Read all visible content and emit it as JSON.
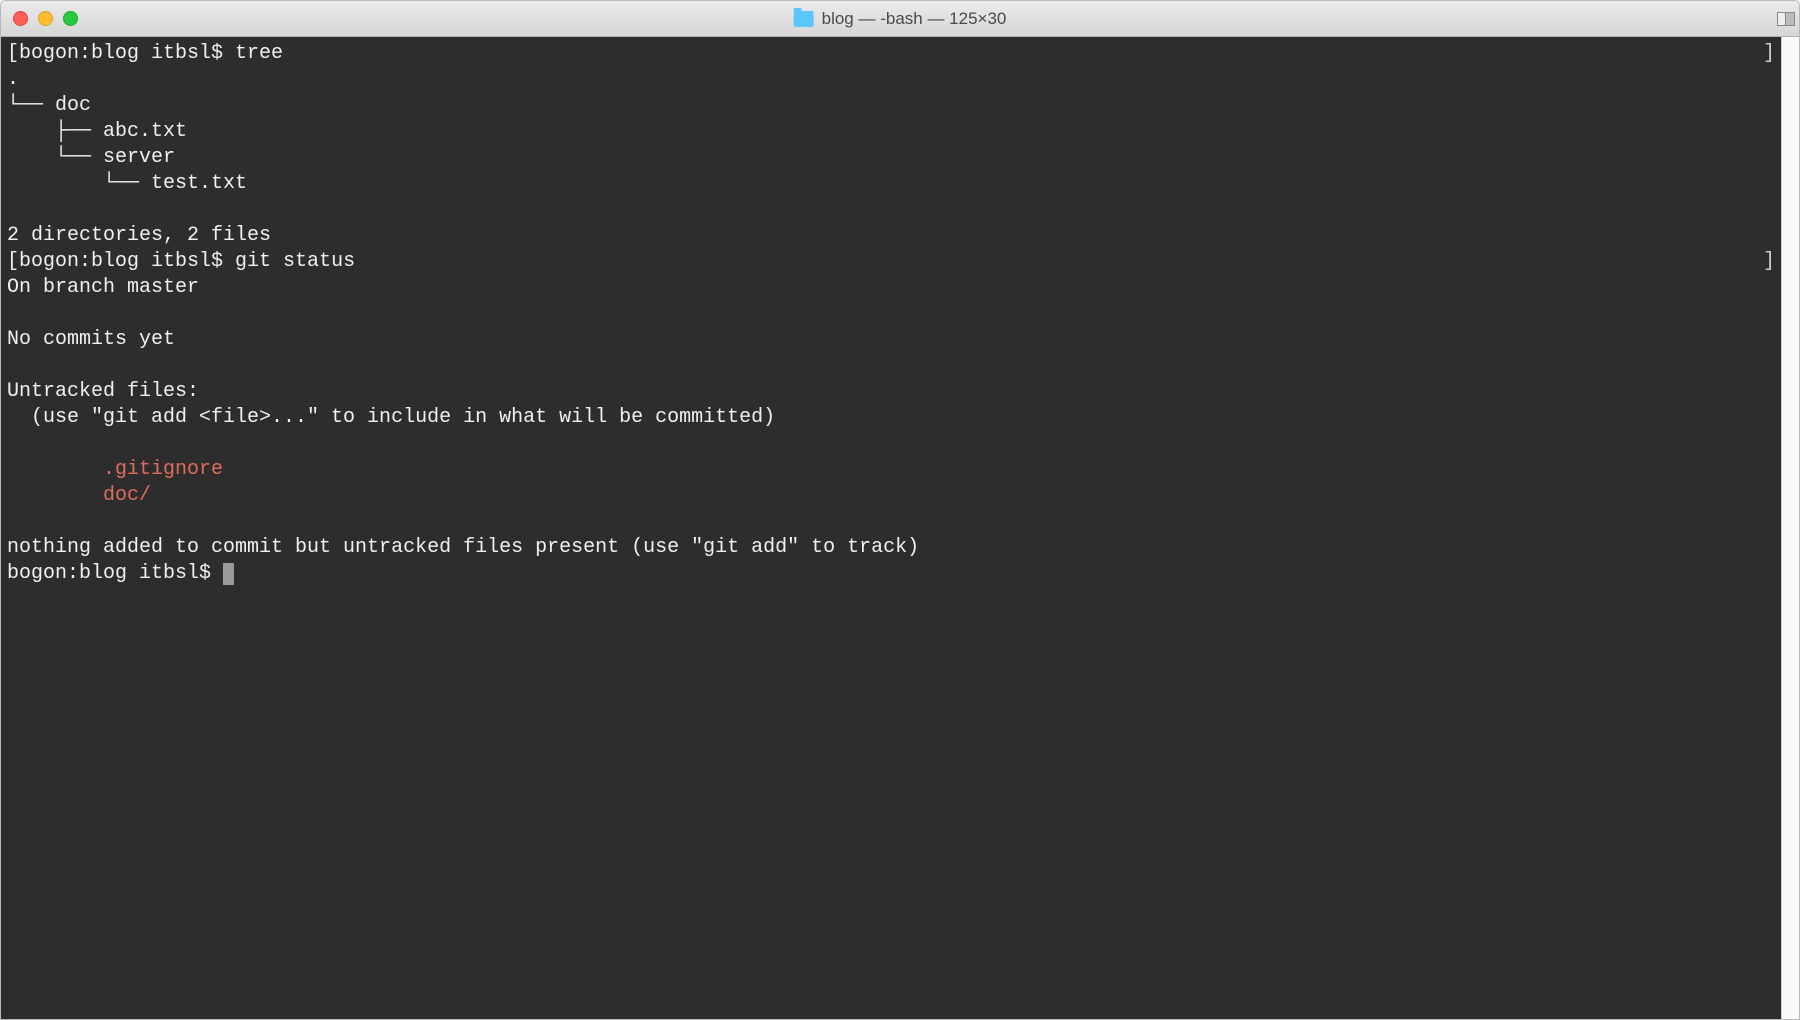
{
  "window": {
    "title": "blog — -bash — 125×30"
  },
  "terminal": {
    "prompt1_open": "[bogon:blog itbsl$ ",
    "cmd1": "tree",
    "prompt1_close_bracket": "]",
    "tree_line_dot": ".",
    "tree_line_doc": "└── doc",
    "tree_line_abc": "    ├── abc.txt",
    "tree_line_server": "    └── server",
    "tree_line_test": "        └── test.txt",
    "tree_summary": "2 directories, 2 files",
    "prompt2_open": "[bogon:blog itbsl$ ",
    "cmd2": "git status",
    "prompt2_close_bracket": "]",
    "git_branch": "On branch master",
    "git_nocommits": "No commits yet",
    "git_untracked_header": "Untracked files:",
    "git_untracked_hint": "  (use \"git add <file>...\" to include in what will be committed)",
    "git_untracked_file1": "        .gitignore",
    "git_untracked_file2": "        doc/",
    "git_nothing": "nothing added to commit but untracked files present (use \"git add\" to track)",
    "prompt3": "bogon:blog itbsl$ "
  },
  "colors": {
    "bg": "#2d2d2d",
    "fg": "#f0f0f0",
    "untracked": "#e06c5c"
  }
}
